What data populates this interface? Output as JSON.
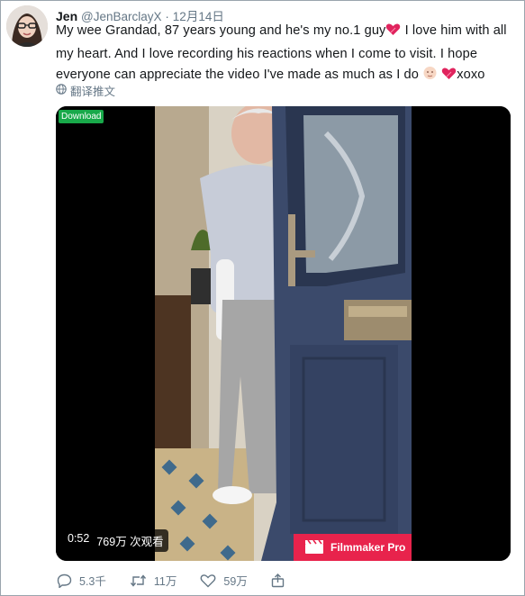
{
  "tweet": {
    "display_name": "Jen",
    "handle": "@JenBarclayX",
    "dot": "·",
    "date": "12月14日",
    "text_part1": "My wee Grandad, 87 years young and he's my no.1 guy",
    "text_part2": " I love him with all my heart. And I love recording his reactions when I come to visit. I hope everyone can appreciate the video I've made as much as I do ",
    "text_part3": "xoxo",
    "translate_label": "翻译推文"
  },
  "media": {
    "download_badge": "Download",
    "duration": "0:52",
    "views": "769万 次观看",
    "watermark": "Filmmaker Pro"
  },
  "actions": {
    "reply_count": "5.3千",
    "retweet_count": "11万",
    "like_count": "59万"
  },
  "colors": {
    "secondary_text": "#657786",
    "download_green": "#18a94a",
    "filmmaker_red": "#e8234c",
    "heart": "#e0245e"
  },
  "icons": [
    "avatar",
    "heart-emoji-icon",
    "face-emoji-icon",
    "globe-icon",
    "reply-icon",
    "retweet-icon",
    "like-icon",
    "share-icon",
    "clapperboard-icon"
  ]
}
